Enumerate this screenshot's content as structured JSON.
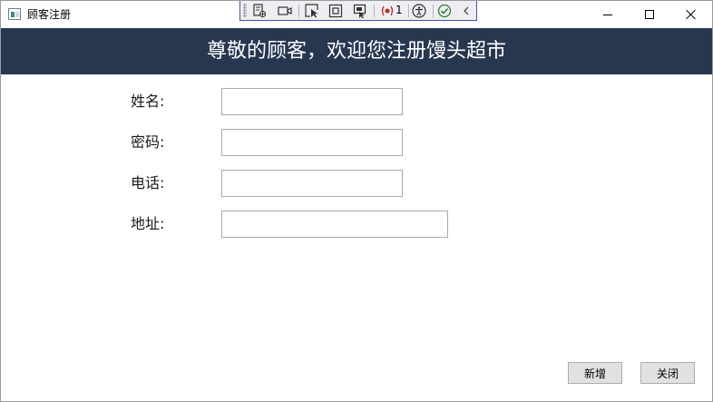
{
  "window": {
    "title": "顾客注册",
    "icon": "app-window-icon",
    "controls": [
      "minimize-icon",
      "maximize-icon",
      "close-icon"
    ]
  },
  "debug_toolbar": {
    "icons": [
      "live-visual-tree-icon",
      "record-icon",
      "select-element-icon",
      "display-layout-adorners-icon",
      "track-focus-icon",
      "binding-failures-icon",
      "accessibility-icon",
      "hot-reload-ok-icon",
      "collapse-chevron-icon"
    ],
    "binding_failure_count": "1"
  },
  "header": {
    "title": "尊敬的顾客，欢迎您注册馒头超市",
    "background": "#283750"
  },
  "form": {
    "fields": [
      {
        "label": "姓名:",
        "value": ""
      },
      {
        "label": "密码:",
        "value": ""
      },
      {
        "label": "电话:",
        "value": ""
      },
      {
        "label": "地址:",
        "value": ""
      }
    ]
  },
  "actions": {
    "add_label": "新增",
    "close_label": "关闭"
  }
}
